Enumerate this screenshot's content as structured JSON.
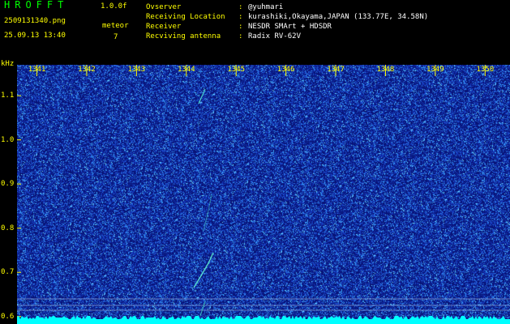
{
  "header": {
    "app_title": "HROFFT",
    "app_version": "1.0.0f",
    "file_name": "2509131340.png",
    "timestamp": "25.09.13 13:40",
    "mode_label": "meteor",
    "mode_count": "7"
  },
  "info": [
    {
      "label": "Ovserver",
      "sep": ":",
      "value": "@yuhmari"
    },
    {
      "label": "Receiving Location",
      "sep": ":",
      "value": "kurashiki,Okayama,JAPAN (133.77E, 34.58N)"
    },
    {
      "label": "Receiver",
      "sep": ":",
      "value": "NESDR SMArt + HDSDR"
    },
    {
      "label": "Recviving antenna",
      "sep": ":",
      "value": "Radix RV-62V"
    }
  ],
  "axes": {
    "unit_label": "kHz",
    "time_ticks": [
      "1341",
      "1342",
      "1343",
      "1344",
      "1345",
      "1346",
      "1347",
      "1348",
      "1349",
      "1350"
    ],
    "freq_ticks": [
      "1.1",
      "1.0",
      "0.9",
      "0.8",
      "0.7",
      "0.6"
    ],
    "freq_range_khz": [
      0.583,
      1.17
    ],
    "time_range_min": [
      1340.6,
      1350.5
    ]
  },
  "colors": {
    "background": "#000000",
    "waterfall": "#0a1a8a",
    "title": "#00ff00",
    "label": "#ffff00",
    "value": "#ffffff",
    "baseline": "#00ffff"
  }
}
